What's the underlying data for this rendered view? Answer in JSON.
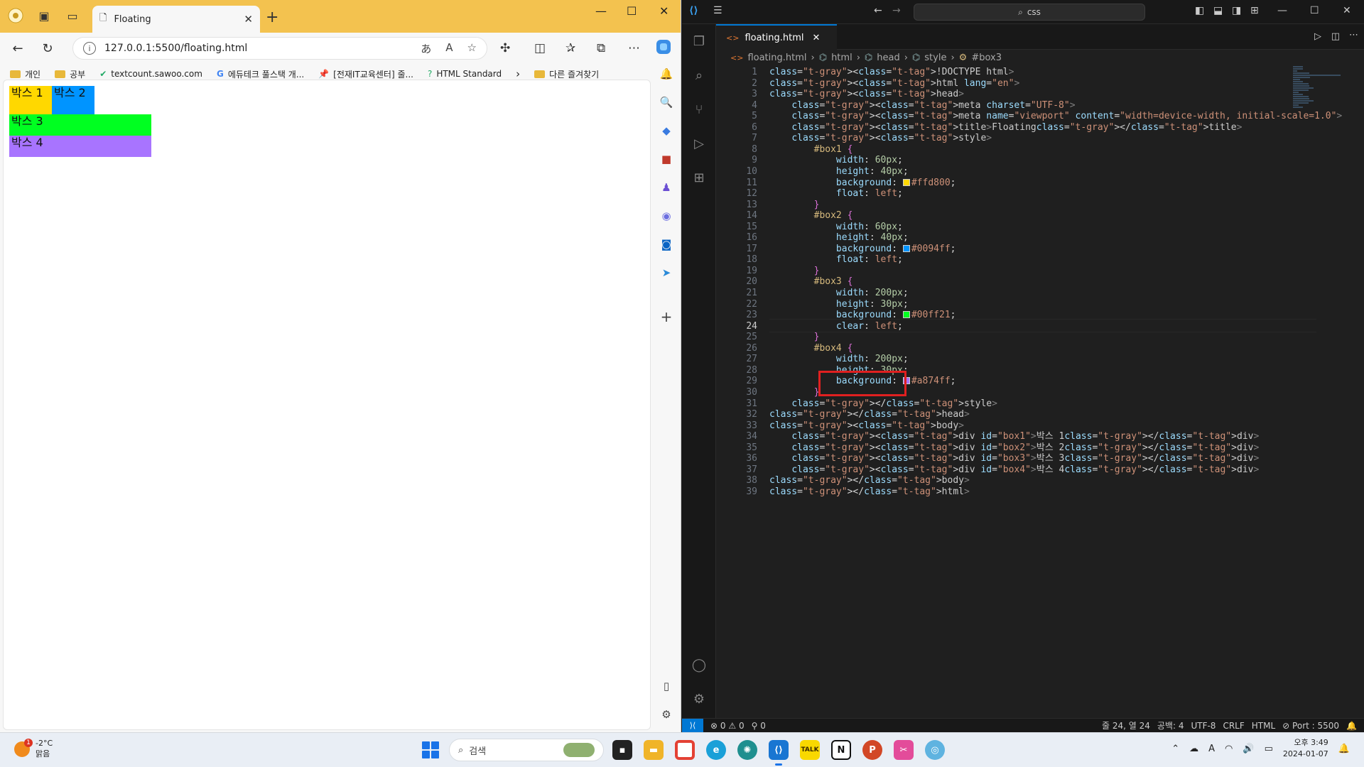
{
  "browser": {
    "tab_title": "Floating",
    "url": "127.0.0.1:5500/floating.html",
    "bookmarks": [
      "개인",
      "공부",
      "textcount.sawoo.com",
      "에듀테크 풀스택 개...",
      "[전재IT교육센터] 줄...",
      "HTML Standard",
      "다른 즐겨찾기"
    ],
    "boxes": [
      {
        "label": "박스 1",
        "color": "#ffd800"
      },
      {
        "label": "박스 2",
        "color": "#0094ff"
      },
      {
        "label": "박스 3",
        "color": "#00ff21"
      },
      {
        "label": "박스 4",
        "color": "#a874ff"
      }
    ]
  },
  "vscode": {
    "search_label": "css",
    "tab_label": "floating.html",
    "breadcrumb": [
      "floating.html",
      "html",
      "head",
      "style",
      "#box3"
    ],
    "status": {
      "errors": "0",
      "warnings": "0",
      "ports": "0",
      "position": "줄 24, 열 24",
      "spaces": "공백: 4",
      "encoding": "UTF-8",
      "eol": "CRLF",
      "language": "HTML",
      "port": "Port : 5500"
    }
  },
  "code_lines": [
    "<!DOCTYPE html>",
    "<html lang=\"en\">",
    "<head>",
    "    <meta charset=\"UTF-8\">",
    "    <meta name=\"viewport\" content=\"width=device-width, initial-scale=1.0\">",
    "    <title>Floating</title>",
    "    <style>",
    "        #box1 {",
    "            width: 60px;",
    "            height: 40px;",
    "            background: #ffd800;",
    "            float: left;",
    "        }",
    "        #box2 {",
    "            width: 60px;",
    "            height: 40px;",
    "            background: #0094ff;",
    "            float: left;",
    "        }",
    "        #box3 {",
    "            width: 200px;",
    "            height: 30px;",
    "            background: #00ff21;",
    "            clear: left;",
    "        }",
    "        #box4 {",
    "            width: 200px;",
    "            height: 30px;",
    "            background: #a874ff;",
    "        }",
    "    </style>",
    "</head>",
    "<body>",
    "    <div id=\"box1\">박스 1</div>",
    "    <div id=\"box2\">박스 2</div>",
    "    <div id=\"box3\">박스 3</div>",
    "    <div id=\"box4\">박스 4</div>",
    "</body>",
    "</html>"
  ],
  "current_line": 24,
  "taskbar": {
    "weather_temp": "-2°C",
    "weather_desc": "맑음",
    "search_placeholder": "검색",
    "time": "오후 3:49",
    "date": "2024-01-07"
  }
}
